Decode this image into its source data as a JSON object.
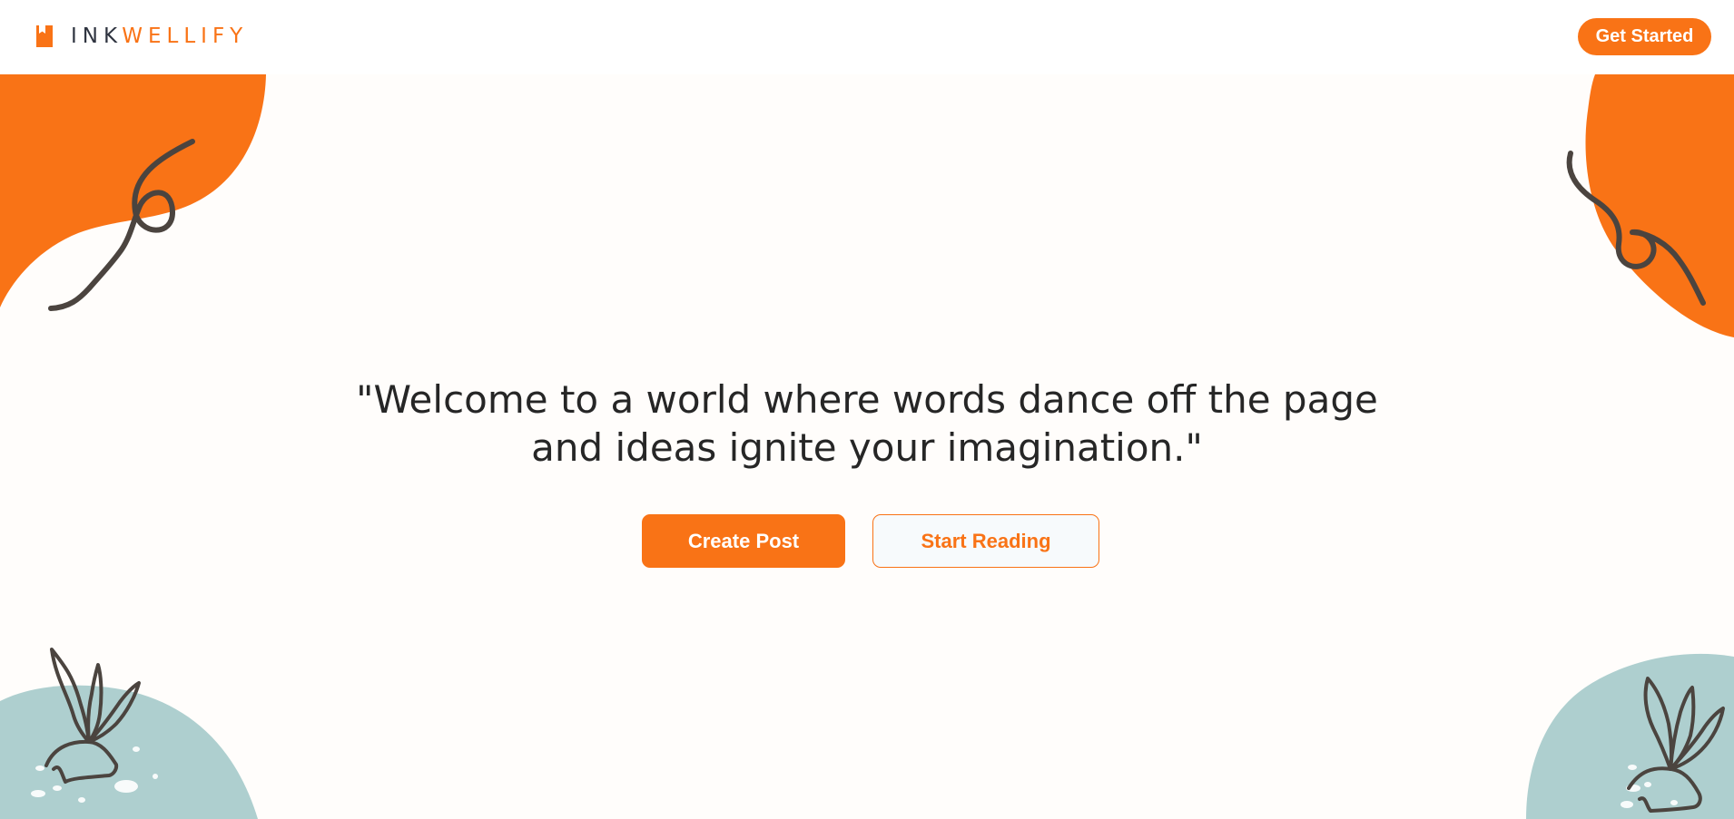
{
  "header": {
    "brand_prefix": "INK",
    "brand_suffix": "WELLIFY",
    "get_started_label": "Get Started"
  },
  "hero": {
    "quote": "\"Welcome to a world where words dance off the page and ideas ignite your imagination.\"",
    "create_post_label": "Create Post",
    "start_reading_label": "Start Reading"
  },
  "colors": {
    "accent": "#f97316",
    "teal": "#aecfcf",
    "line": "#4b443f",
    "text": "#262626"
  }
}
